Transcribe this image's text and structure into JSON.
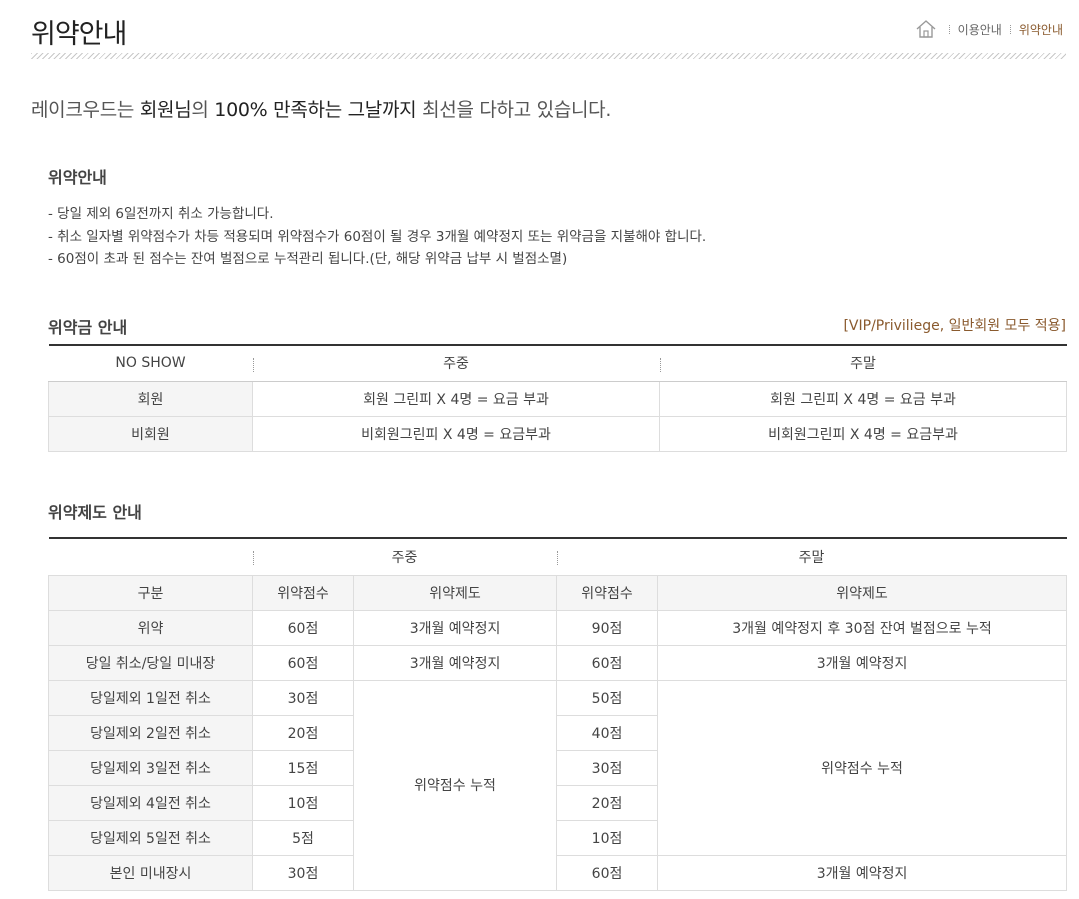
{
  "header": {
    "title": "위약안내",
    "breadcrumb": [
      "이용안내",
      "위약안내"
    ]
  },
  "intro": {
    "part1": "레이크우드는 ",
    "bold1": "회원님",
    "part2": "의 ",
    "bold2": "100% 만족하는 그날까지",
    "part3": " 최선을 다하고 있습니다."
  },
  "notice": {
    "title": "위약안내",
    "items": [
      "- 당일 제외 6일전까지 취소 가능합니다.",
      "- 취소 일자별 위약점수가 차등 적용되며 위약점수가 60점이 될 경우 3개월 예약정지 또는 위약금을 지불해야 합니다.",
      "- 60점이 초과 된 점수는 잔여 벌점으로 누적관리 됩니다.(단, 해당 위약금 납부 시 벌점소멸)"
    ]
  },
  "fee": {
    "title": "위약금 안내",
    "note": "[VIP/Priviliege, 일반회원 모두 적용]",
    "headers": [
      "NO SHOW",
      "주중",
      "주말"
    ],
    "rows": [
      [
        "회원",
        "회원 그린피 X 4명 = 요금 부과",
        "회원 그린피 X 4명 = 요금 부과"
      ],
      [
        "비회원",
        "비회원그린피 X 4명 = 요금부과",
        "비회원그린피 X 4명 = 요금부과"
      ]
    ]
  },
  "system": {
    "title": "위약제도 안내",
    "group_headers": [
      "",
      "주중",
      "주말"
    ],
    "sub_headers": [
      "구분",
      "위약점수",
      "위약제도",
      "위약점수",
      "위약제도"
    ],
    "rows": [
      {
        "label": "위약",
        "wk_score": "60점",
        "wk_rule": "3개월 예약정지",
        "we_score": "90점",
        "we_rule": "3개월 예약정지 후 30점 잔여 벌점으로 누적"
      },
      {
        "label": "당일 취소/당일 미내장",
        "wk_score": "60점",
        "wk_rule": "3개월 예약정지",
        "we_score": "60점",
        "we_rule": "3개월 예약정지"
      },
      {
        "label": "당일제외 1일전 취소",
        "wk_score": "30점",
        "we_score": "50점"
      },
      {
        "label": "당일제외 2일전 취소",
        "wk_score": "20점",
        "we_score": "40점"
      },
      {
        "label": "당일제외 3일전 취소",
        "wk_score": "15점",
        "we_score": "30점"
      },
      {
        "label": "당일제외 4일전 취소",
        "wk_score": "10점",
        "we_score": "20점"
      },
      {
        "label": "당일제외 5일전 취소",
        "wk_score": "5점",
        "we_score": "10점"
      },
      {
        "label": "본인 미내장시",
        "wk_score": "30점",
        "we_score": "60점",
        "we_rule": "3개월 예약정지"
      }
    ],
    "merged_wk_rule": "위약점수 누적",
    "merged_we_rule": "위약점수 누적"
  }
}
